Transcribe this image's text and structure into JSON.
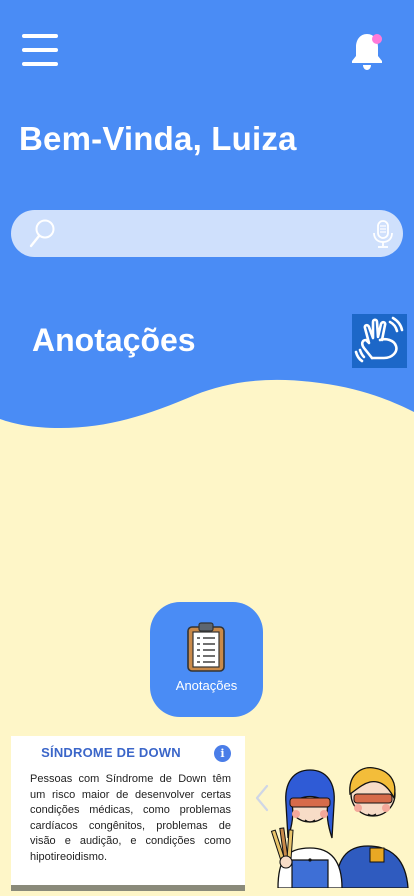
{
  "header": {
    "greeting": "Bem-Vinda, Luiza"
  },
  "search": {
    "placeholder": "",
    "value": ""
  },
  "section": {
    "title": "Anotações"
  },
  "notes_card": {
    "label": "Anotações",
    "icon": "clipboard-icon"
  },
  "info_card": {
    "title": "SÍNDROME DE DOWN",
    "body": "Pessoas com Síndrome de Down têm um risco maior de desenvolver certas condições médicas, como problemas cardíacos congênitos, problemas de visão e audição, e condições como hipotireoidismo.",
    "info_icon_label": "i"
  },
  "colors": {
    "header_blue": "#4a8cf5",
    "background_cream": "#fef6c8",
    "search_bg": "#cfe0fc",
    "notification_dot": "#ff7ad9",
    "accent_title": "#3b66c9"
  }
}
